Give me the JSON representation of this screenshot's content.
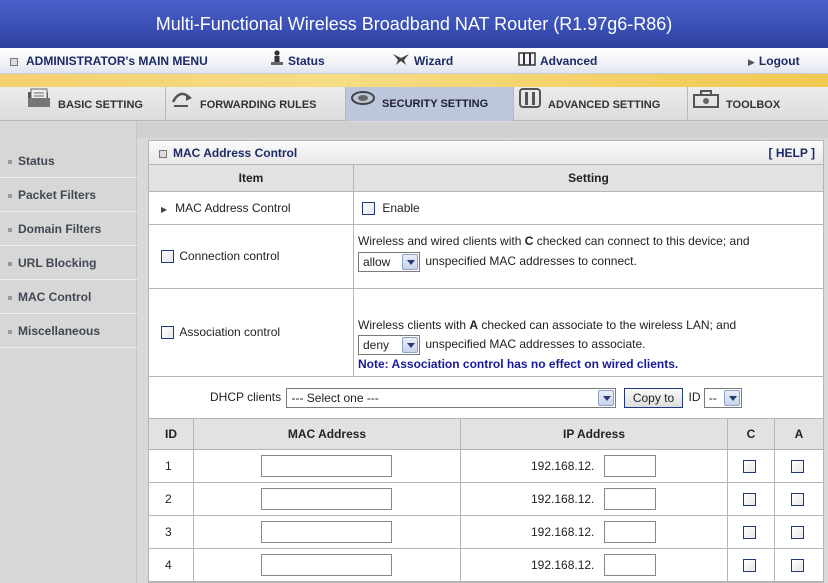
{
  "title": "Multi-Functional Wireless Broadband NAT Router (R1.97g6-R86)",
  "menu": {
    "admin": "ADMINISTRATOR's MAIN MENU",
    "status": "Status",
    "wizard": "Wizard",
    "advanced": "Advanced",
    "logout": "Logout"
  },
  "tabs": [
    {
      "label": "BASIC SETTING",
      "icon": "folder-icon"
    },
    {
      "label": "FORWARDING RULES",
      "icon": "forward-arrows-icon"
    },
    {
      "label": "SECURITY SETTING",
      "icon": "lock-icon"
    },
    {
      "label": "ADVANCED SETTING",
      "icon": "advanced-settings-icon"
    },
    {
      "label": "TOOLBOX",
      "icon": "toolbox-icon"
    }
  ],
  "active_tab": "SECURITY SETTING",
  "sidebar": {
    "items": [
      {
        "label": "Status"
      },
      {
        "label": "Packet Filters"
      },
      {
        "label": "Domain Filters"
      },
      {
        "label": "URL Blocking"
      },
      {
        "label": "MAC Control"
      },
      {
        "label": "Miscellaneous"
      }
    ]
  },
  "panel": {
    "title": "MAC Address Control",
    "help": "[ HELP ]",
    "col_item": "Item",
    "col_setting": "Setting",
    "mac_control_label": "MAC Address Control",
    "enable_label": "Enable",
    "connection_label": "Connection control",
    "connection_text1_a": "Wireless and wired clients with ",
    "connection_text1_b": "C",
    "connection_text1_c": " checked can connect to this device; and",
    "connection_select": "allow",
    "connection_text2": "unspecified MAC addresses to connect.",
    "association_label": "Association control",
    "association_text1_a": "Wireless clients with ",
    "association_text1_b": "A",
    "association_text1_c": " checked can associate to the wireless LAN; and",
    "association_select": "deny",
    "association_text2": "unspecified MAC addresses to associate.",
    "association_note": "Note: Association control has no effect on wired clients.",
    "dhcp_label": "DHCP clients",
    "dhcp_select": "--- Select one ---",
    "copy_button": "Copy to",
    "id_label": "ID",
    "id_select": "--"
  },
  "table": {
    "headers": [
      "ID",
      "MAC Address",
      "IP Address",
      "C",
      "A"
    ],
    "ip_prefix": "192.168.12.",
    "rows": [
      {
        "id": "1",
        "mac": "",
        "ip_suffix": ""
      },
      {
        "id": "2",
        "mac": "",
        "ip_suffix": ""
      },
      {
        "id": "3",
        "mac": "",
        "ip_suffix": ""
      },
      {
        "id": "4",
        "mac": "",
        "ip_suffix": ""
      }
    ]
  },
  "colors": {
    "title_bg": "#3c52b8",
    "accent_text": "#1c2a66",
    "orange_strip": "#f6dc84",
    "active_tab_bg": "#bcc7dc",
    "note_text": "#181a9c"
  }
}
